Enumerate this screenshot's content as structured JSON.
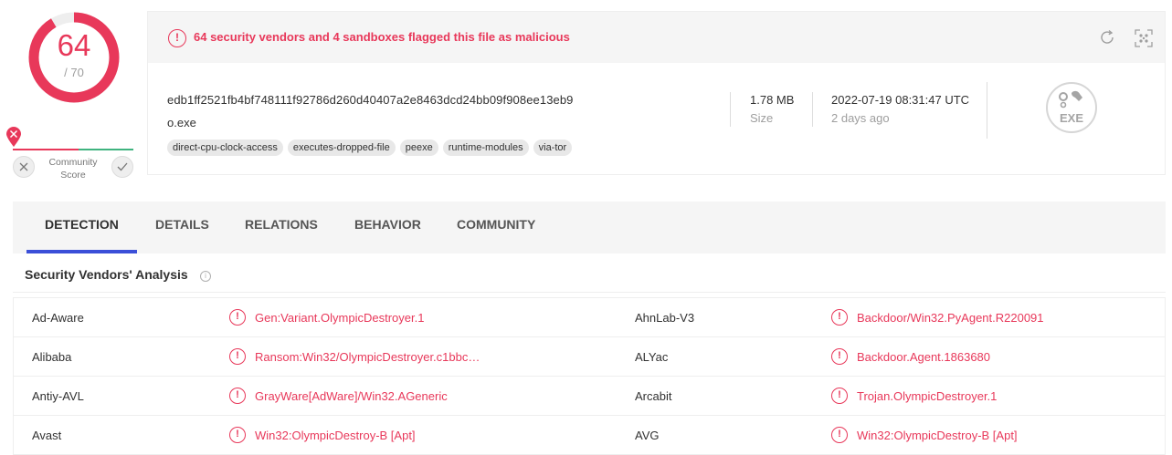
{
  "score": {
    "detections": "64",
    "total": "/ 70",
    "ratio": 0.914,
    "accent": "#e8385a",
    "track": "#eeeeee"
  },
  "community": {
    "label_line1": "Community",
    "label_line2": "Score",
    "vote_down_icon": "close-icon",
    "vote_up_icon": "check-icon"
  },
  "summary": {
    "alert": "64 security vendors and 4 sandboxes flagged this file as malicious",
    "hash": "edb1ff2521fb4bf748111f92786d260d40407a2e8463dcd24bb09f908ee13eb9",
    "filename": "o.exe",
    "tags": [
      "direct-cpu-clock-access",
      "executes-dropped-file",
      "peexe",
      "runtime-modules",
      "via-tor"
    ],
    "size_value": "1.78 MB",
    "size_label": "Size",
    "date_value": "2022-07-19 08:31:47 UTC",
    "date_label": "2 days ago",
    "file_type": "EXE"
  },
  "tabs": [
    "DETECTION",
    "DETAILS",
    "RELATIONS",
    "BEHAVIOR",
    "COMMUNITY"
  ],
  "active_tab": "DETECTION",
  "analysis": {
    "title": "Security Vendors' Analysis",
    "rows": [
      {
        "vendor1": "Ad-Aware",
        "result1": "Gen:Variant.OlympicDestroyer.1",
        "vendor2": "AhnLab-V3",
        "result2": "Backdoor/Win32.PyAgent.R220091"
      },
      {
        "vendor1": "Alibaba",
        "result1": "Ransom:Win32/OlympicDestroyer.c1bbc…",
        "vendor2": "ALYac",
        "result2": "Backdoor.Agent.1863680"
      },
      {
        "vendor1": "Antiy-AVL",
        "result1": "GrayWare[AdWare]/Win32.AGeneric",
        "vendor2": "Arcabit",
        "result2": "Trojan.OlympicDestroyer.1"
      },
      {
        "vendor1": "Avast",
        "result1": "Win32:OlympicDestroy-B [Apt]",
        "vendor2": "AVG",
        "result2": "Win32:OlympicDestroy-B [Apt]"
      }
    ]
  },
  "colors": {
    "malicious": "#e8385a",
    "tab_indicator": "#3b4fd8"
  }
}
